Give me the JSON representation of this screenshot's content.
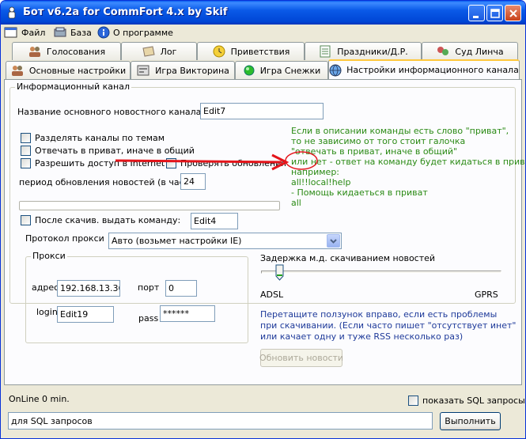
{
  "window": {
    "title": "Бот v6.2a for CommFort 4.x by Skif"
  },
  "menu": {
    "file": "Файл",
    "db": "База",
    "about": "О программе"
  },
  "tabs_row1": [
    "Голосования",
    "Лог",
    "Приветствия",
    "Праздники/Д.Р.",
    "Суд Линча"
  ],
  "tabs_row2": [
    "Основные настройки",
    "Игра Викторина",
    "Игра Снежки",
    "Настройки информационного канала"
  ],
  "info_group": {
    "label": "Информационный канал",
    "main_channel_label": "Название основного новостного канала",
    "main_channel_value": "Edit7",
    "chk_split": "Разделять каналы по темам",
    "chk_private": "Отвечать в приват, иначе в общий",
    "chk_internet": "Разрешить доступ в Internet",
    "chk_updates": "Проверять обновления",
    "period_label": "период обновления новостей (в часах)",
    "period_value": "24",
    "after_dl_label": "После скачив. выдать команду:",
    "after_dl_value": "Edit4",
    "proxy_protocol_label": "Протокол прокси",
    "proxy_protocol_value": "Авто (возьмет настройки IE)"
  },
  "help_text": [
    "Если в описании команды есть слово \"приват\",",
    "то не зависимо от того стоит галочка",
    "\"отвечать в приват, иначе в общий\"",
    "или нет - ответ на команду будет кидаться в приват.",
    "например:",
    "all!!local!help",
    "- Помощь кидаеться в приват",
    "all"
  ],
  "proxy_group": {
    "label": "Прокси",
    "addr_label": "адрес",
    "addr_value": "192.168.13.36",
    "port_label": "порт",
    "port_value": "0",
    "login_label": "login",
    "login_value": "Edit19",
    "pass_label": "pass",
    "pass_value": "******"
  },
  "delay": {
    "label": "Задержка м.д. скачиванием новостей",
    "min_label": "ADSL",
    "max_label": "GPRS",
    "position": 0.06
  },
  "hint_text": [
    "Перетащите ползунок вправо, если есть проблемы",
    "при скачивании. (Если часто пишет \"отсутствует инет\"",
    "или качает одну и туже RSS несколько раз)"
  ],
  "update_button": "Обновить новости",
  "status": {
    "online": "OnLine 0 min.",
    "show_sql_label": "показать SQL запросы",
    "sql_value": "для SQL запросов",
    "execute_button": "Выполнить"
  },
  "colors": {
    "help_text": "#2a8a14",
    "hint_text": "#1e3a9a",
    "arrow": "#e4141a"
  }
}
